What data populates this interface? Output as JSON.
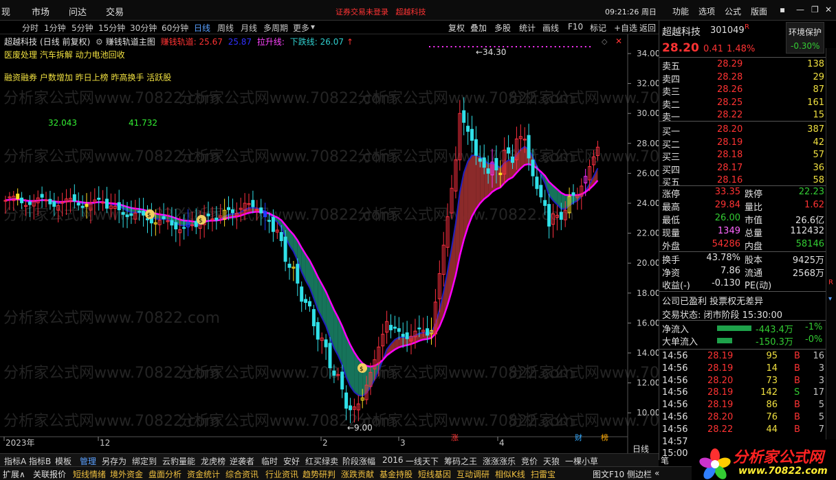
{
  "top_menu": {
    "items": [
      "现",
      "市场",
      "问达",
      "交易"
    ],
    "alert": "证券交易未登录",
    "alert_stock": "超越科技",
    "clock": "09:21:26 周日",
    "right_items": [
      "功能",
      "选项",
      "公式",
      "版面"
    ]
  },
  "periods": {
    "items": [
      "分时",
      "1分钟",
      "5分钟",
      "15分钟",
      "30分钟",
      "60分钟",
      "日线",
      "周线",
      "月线",
      "多周期",
      "更多"
    ],
    "active": "日线",
    "tools": [
      "复权",
      "叠加",
      "多股",
      "统计",
      "画线",
      "F10",
      "标记",
      "+自选",
      "返回"
    ]
  },
  "info_line": {
    "stock": "超越科技",
    "mode": "(日线 前复权)",
    "indicator": "赚钱轨道主图",
    "line1_label": "赚钱轨道: 25.67",
    "line2_label": "25.87",
    "line3_label": "拉升线:",
    "line4_label": "下跌线: 26.07"
  },
  "concepts": {
    "line1": "医废处理 汽车拆解 动力电池回收",
    "line2": "融资融券 户数增加 昨日上榜 昨高换手 活跃股"
  },
  "overlay_numbers": {
    "left": "32.043",
    "right": "41.732"
  },
  "watermark": "分析家公式网www.70822.com",
  "chart_data": {
    "type": "candlestick",
    "y_ticks": [
      "34.00",
      "32.00",
      "30.00",
      "28.00",
      "26.00",
      "24.00",
      "22.00",
      "20.00",
      "18.00",
      "16.00",
      "14.00",
      "12.00",
      "10.00"
    ],
    "ylim": [
      9.0,
      35.0
    ],
    "x_labels": [
      "2023年",
      "12",
      "2",
      "3",
      "4"
    ],
    "high_annotation": "34.30",
    "low_annotation": "9.00",
    "bottom_markers": [
      "涨",
      "财",
      "榜"
    ],
    "period_label": "日线",
    "series": [
      {
        "name": "赚钱轨道",
        "color": "#ff00ff"
      },
      {
        "name": "拉升线",
        "color": "#b03030"
      },
      {
        "name": "下跌线",
        "color": "#1a8060"
      }
    ]
  },
  "quote": {
    "name": "超越科技",
    "code": "301049",
    "tag": "R",
    "env_label": "环境保护",
    "env_change": "-0.30%",
    "price": "28.20",
    "change": "0.41",
    "change_pct": "1.48%",
    "asks": [
      {
        "label": "卖五",
        "price": "28.29",
        "vol": "138"
      },
      {
        "label": "卖四",
        "price": "28.28",
        "vol": "29"
      },
      {
        "label": "卖三",
        "price": "28.26",
        "vol": "87"
      },
      {
        "label": "卖二",
        "price": "28.25",
        "vol": "161"
      },
      {
        "label": "卖一",
        "price": "28.22",
        "vol": "15"
      }
    ],
    "bids": [
      {
        "label": "买一",
        "price": "28.20",
        "vol": "387"
      },
      {
        "label": "买二",
        "price": "28.19",
        "vol": "42"
      },
      {
        "label": "买三",
        "price": "28.18",
        "vol": "57"
      },
      {
        "label": "买四",
        "price": "28.17",
        "vol": "36"
      },
      {
        "label": "买五",
        "price": "28.16",
        "vol": "58"
      }
    ],
    "stats": [
      {
        "l1": "涨停",
        "v1": "33.35",
        "c1": "#ff3333",
        "l2": "跌停",
        "v2": "22.23",
        "c2": "#33cc33"
      },
      {
        "l1": "最高",
        "v1": "29.84",
        "c1": "#ff3333",
        "l2": "量比",
        "v2": "1.62",
        "c2": "#ff3333"
      },
      {
        "l1": "最低",
        "v1": "26.00",
        "c1": "#33cc33",
        "l2": "市值",
        "v2": "26.6亿",
        "c2": "#e0e0e0"
      },
      {
        "l1": "现量",
        "v1": "1349",
        "c1": "#ff66ff",
        "l2": "总量",
        "v2": "112432",
        "c2": "#e0e0e0"
      },
      {
        "l1": "外盘",
        "v1": "54286",
        "c1": "#ff3333",
        "l2": "内盘",
        "v2": "58146",
        "c2": "#33cc33"
      }
    ],
    "stats2": [
      {
        "l1": "换手",
        "v1": "43.78%",
        "l2": "股本",
        "v2": "9425万"
      },
      {
        "l1": "净资",
        "v1": "7.86",
        "l2": "流通",
        "v2": "2568万"
      },
      {
        "l1": "收益(-)",
        "v1": "-0.130",
        "l2": "PE(动)",
        "v2": ""
      }
    ],
    "company_status": "公司已盈利 投票权无差异",
    "trade_status": "交易状态: 闭市阶段 15:30:00",
    "net_inflow_label": "净流入",
    "net_inflow": "-443.4万",
    "net_inflow_pct": "-1%",
    "big_inflow_label": "大单流入",
    "big_inflow": "-150.3万",
    "big_inflow_pct": "-0%",
    "ticks": [
      {
        "time": "14:56",
        "price": "28.19",
        "vol": "95",
        "side": "B",
        "n": "16"
      },
      {
        "time": "14:56",
        "price": "28.19",
        "vol": "14",
        "side": "B",
        "n": "3"
      },
      {
        "time": "14:56",
        "price": "28.20",
        "vol": "73",
        "side": "B",
        "n": "3"
      },
      {
        "time": "14:56",
        "price": "28.19",
        "vol": "142",
        "side": "S",
        "n": "17"
      },
      {
        "time": "14:56",
        "price": "28.19",
        "vol": "86",
        "side": "B",
        "n": "5"
      },
      {
        "time": "14:56",
        "price": "28.20",
        "vol": "76",
        "side": "B",
        "n": "5"
      },
      {
        "time": "14:56",
        "price": "28.22",
        "vol": "44",
        "side": "B",
        "n": "7"
      },
      {
        "time": "14:57",
        "price": "",
        "vol": "",
        "side": "",
        "n": ""
      },
      {
        "time": "15:00",
        "price": "",
        "vol": "",
        "side": "",
        "n": ""
      }
    ],
    "pen_label": "笔"
  },
  "bottom_tabs": [
    "指标A",
    "指标B",
    "模板",
    "管理",
    "另存为",
    "绑定到",
    "云豹量能",
    "龙虎榜",
    "逆袭者",
    "临时",
    "安好",
    "红买绿卖",
    "阶段涨幅",
    "2016",
    "一线天下",
    "筹码之王",
    "涨涨涨乐",
    "竞价",
    "天狼",
    "一棵小草"
  ],
  "bottom_tabs_active": "管理",
  "bottom_tabs2": [
    "扩展∧",
    "关联报价",
    "短线情绪",
    "境外资金",
    "盘面分析",
    "资金统计",
    "综合资讯",
    "行业资讯",
    "趋势研判",
    "涨跌贡献",
    "基金持股",
    "短线基因",
    "互动调研",
    "相似K线",
    "扫雷宝",
    "图文F10",
    "侧边栏",
    "«"
  ],
  "logo_text": "分析家公式网",
  "logo_url": "www.70822.com"
}
